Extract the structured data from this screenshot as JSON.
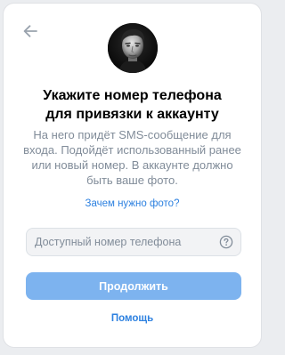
{
  "header": {
    "back_icon": "arrow-left-icon"
  },
  "profile": {
    "avatar": "user-photo"
  },
  "main": {
    "title_line1": "Укажите номер телефона",
    "title_line2": "для привязки к аккаунту",
    "description": "На него придёт SMS-сообщение для входа. Подойдёт использованный ранее или новый номер. В аккаунте должно быть ваше фото.",
    "why_photo_link": "Зачем нужно фото?"
  },
  "phone_input": {
    "placeholder": "Доступный номер телефона",
    "value": "",
    "help_icon": "question-circle-icon"
  },
  "actions": {
    "continue_label": "Продолжить",
    "help_label": "Помощь"
  },
  "colors": {
    "background": "#ebedf0",
    "card": "#ffffff",
    "accent": "#2d81e0",
    "button_disabled": "#7db3ef",
    "secondary_text": "#818c99"
  }
}
